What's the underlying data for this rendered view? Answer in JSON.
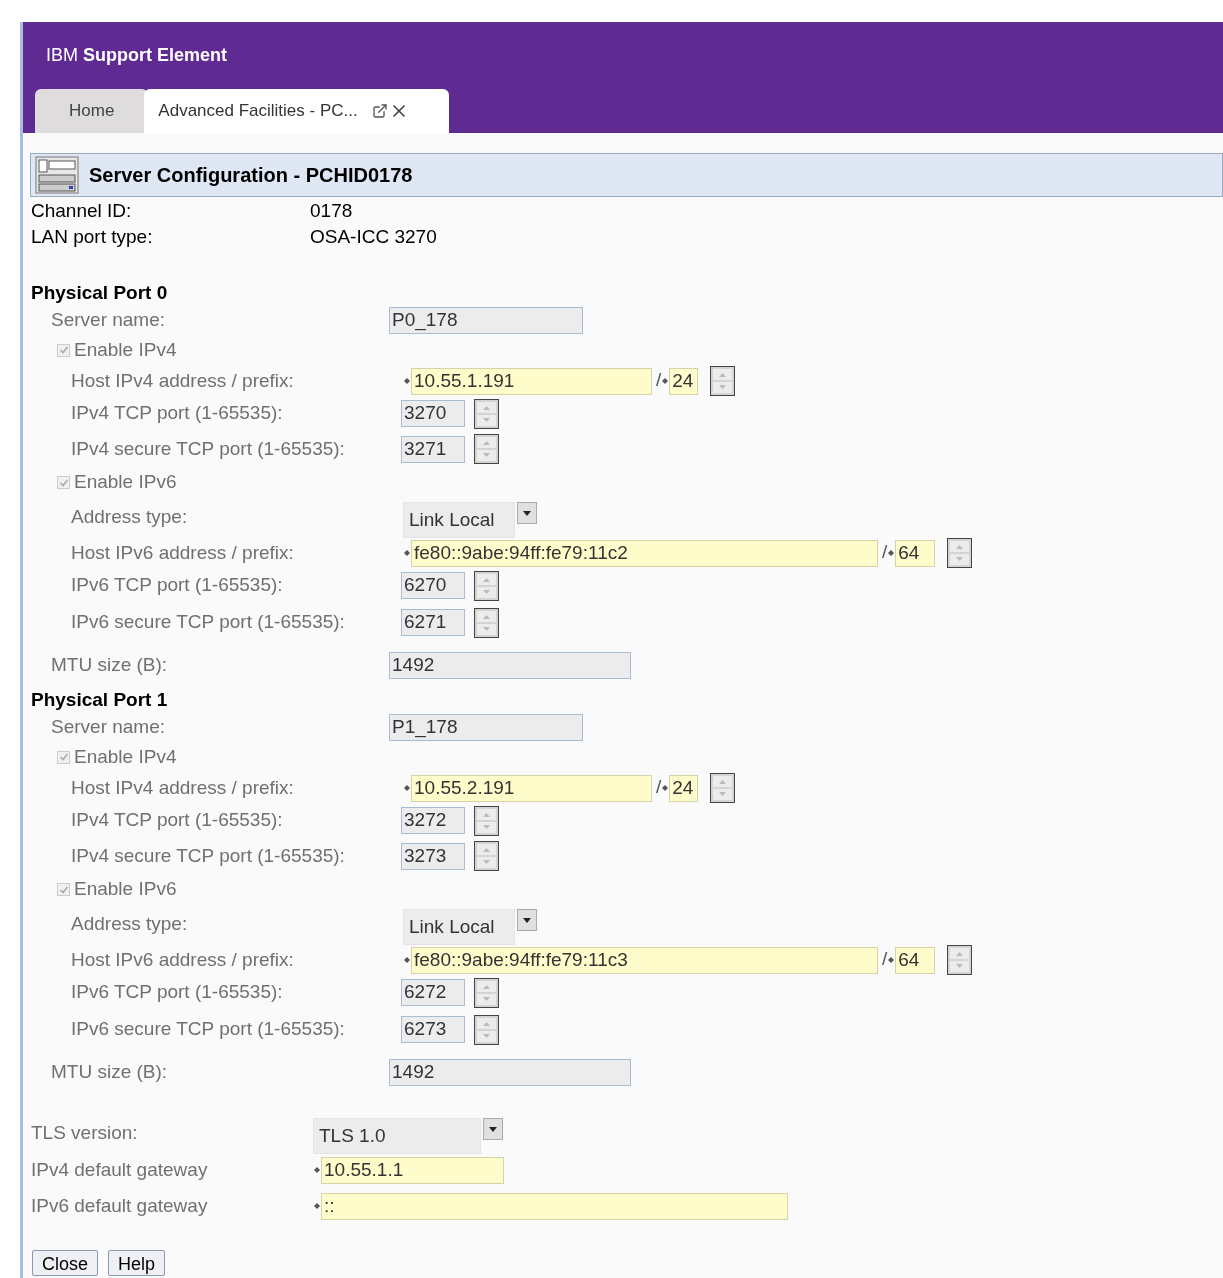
{
  "app_title": {
    "brand": "IBM",
    "product": "Support Element"
  },
  "tabs": [
    {
      "label": "Home",
      "selected": false,
      "closable": false
    },
    {
      "label": "Advanced Facilities - PC...",
      "selected": true,
      "closable": true
    }
  ],
  "panel_title": "Server Configuration - PCHID0178",
  "info": [
    {
      "label": "Channel ID:",
      "value": "0178"
    },
    {
      "label": "LAN port type:",
      "value": "OSA-ICC 3270"
    }
  ],
  "ports": [
    {
      "heading": "Physical Port 0",
      "server_name": {
        "label": "Server name:",
        "value": "P0_178"
      },
      "ipv4": {
        "enable": {
          "label": "Enable IPv4",
          "checked": true
        },
        "host": {
          "label": "Host IPv4 address / prefix:",
          "address": "10.55.1.191",
          "separator": "/",
          "prefix": "24",
          "required": true
        },
        "ports": [
          {
            "label": "IPv4 TCP port (1-65535):",
            "value": "3270"
          },
          {
            "label": "IPv4 secure TCP port (1-65535):",
            "value": "3271"
          }
        ]
      },
      "ipv6": {
        "enable": {
          "label": "Enable IPv6",
          "checked": true
        },
        "address_type": {
          "label": "Address type:",
          "value": "Link Local"
        },
        "host": {
          "label": "Host IPv6 address / prefix:",
          "address": "fe80::9abe:94ff:fe79:11c2",
          "separator": "/",
          "prefix": "64",
          "required": true
        },
        "ports": [
          {
            "label": "IPv6 TCP port (1-65535):",
            "value": "6270"
          },
          {
            "label": "IPv6 secure TCP port (1-65535):",
            "value": "6271"
          }
        ]
      },
      "mtu": {
        "label": "MTU size (B):",
        "value": "1492"
      }
    },
    {
      "heading": "Physical Port 1",
      "server_name": {
        "label": "Server name:",
        "value": "P1_178"
      },
      "ipv4": {
        "enable": {
          "label": "Enable IPv4",
          "checked": true
        },
        "host": {
          "label": "Host IPv4 address / prefix:",
          "address": "10.55.2.191",
          "separator": "/",
          "prefix": "24",
          "required": true
        },
        "ports": [
          {
            "label": "IPv4 TCP port (1-65535):",
            "value": "3272"
          },
          {
            "label": "IPv4 secure TCP port (1-65535):",
            "value": "3273"
          }
        ]
      },
      "ipv6": {
        "enable": {
          "label": "Enable IPv6",
          "checked": true
        },
        "address_type": {
          "label": "Address type:",
          "value": "Link Local"
        },
        "host": {
          "label": "Host IPv6 address / prefix:",
          "address": "fe80::9abe:94ff:fe79:11c3",
          "separator": "/",
          "prefix": "64",
          "required": true
        },
        "ports": [
          {
            "label": "IPv6 TCP port (1-65535):",
            "value": "6272"
          },
          {
            "label": "IPv6 secure TCP port (1-65535):",
            "value": "6273"
          }
        ]
      },
      "mtu": {
        "label": "MTU size (B):",
        "value": "1492"
      }
    }
  ],
  "tls": {
    "label": "TLS version:",
    "value": "TLS 1.0"
  },
  "gateways": [
    {
      "label": "IPv4 default gateway",
      "value": "10.55.1.1",
      "required": true,
      "wide": false
    },
    {
      "label": "IPv6 default gateway",
      "value": "::",
      "required": true,
      "wide": true
    }
  ],
  "buttons": [
    "Close",
    "Help"
  ]
}
